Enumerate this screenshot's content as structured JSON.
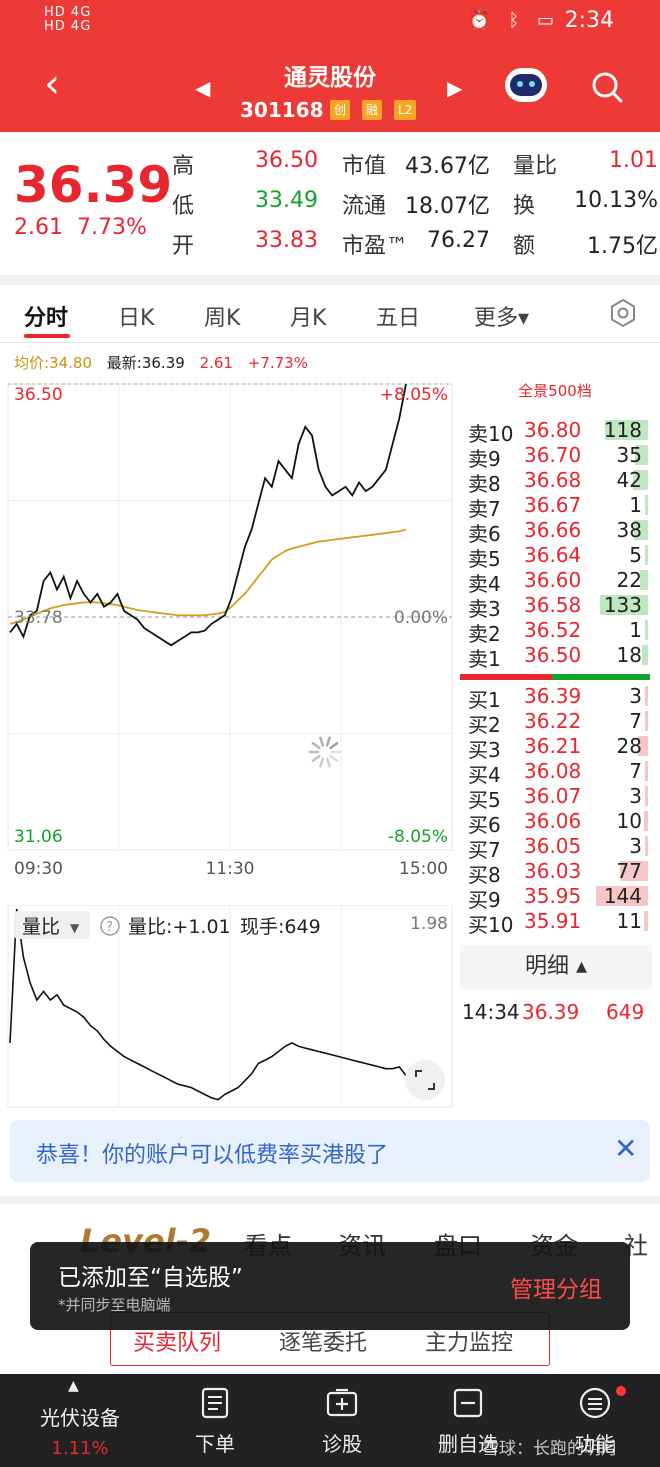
{
  "status_bar": {
    "network_left": "HD 4G",
    "network_left2": "HD 4G",
    "time": "2:34"
  },
  "header": {
    "back_icon": "back-arrow-icon",
    "stock_name": "通灵股份",
    "stock_code": "301168",
    "tags": [
      "创",
      "融",
      "L2"
    ],
    "robot_icon": "robot-icon",
    "search_icon": "search-icon"
  },
  "quote": {
    "price": "36.39",
    "change": "2.61",
    "change_pct": "7.73%",
    "rows": [
      {
        "l1": "高",
        "v1": "36.50",
        "c1": "red",
        "l2": "市值",
        "v2": "43.67亿",
        "l3": "量比",
        "v3": "1.01",
        "c3": "red"
      },
      {
        "l1": "低",
        "v1": "33.49",
        "c1": "green",
        "l2": "流通",
        "v2": "18.07亿",
        "l3": "换",
        "v3": "10.13%",
        "c3": "dark"
      },
      {
        "l1": "开",
        "v1": "33.83",
        "c1": "red",
        "l2": "市盈™",
        "v2": "76.27",
        "l3": "额",
        "v3": "1.75亿",
        "c3": "dark"
      }
    ]
  },
  "tabs": [
    "分时",
    "日K",
    "周K",
    "月K",
    "五日",
    "更多▾"
  ],
  "chart_info": {
    "avg_label": "均价:34.80",
    "latest_label": "最新:36.39",
    "change": "2.61",
    "change_pct": "+7.73%"
  },
  "chart_data": [
    {
      "type": "line",
      "y_top_label": "36.50",
      "y_mid_label": "33.78",
      "y_bottom_label": "31.06",
      "pct_top_label": "+8.05%",
      "pct_mid_label": "0.00%",
      "pct_bottom_label": "-8.05%",
      "x_labels": [
        "09:30",
        "11:30",
        "15:00"
      ],
      "ylim": [
        31.06,
        36.5
      ],
      "prev_close": 33.78,
      "series": [
        {
          "values": [
            33.6,
            33.7,
            33.55,
            33.8,
            33.85,
            34.2,
            34.3,
            34.1,
            34.25,
            34.0,
            34.2,
            34.05,
            33.95,
            34.05,
            33.9,
            33.95,
            34.05,
            33.85,
            33.8,
            33.75,
            33.65,
            33.6,
            33.55,
            33.5,
            33.45,
            33.5,
            33.55,
            33.6,
            33.6,
            33.62,
            33.7,
            33.75,
            33.8,
            34.0,
            34.3,
            34.6,
            34.8,
            35.1,
            35.4,
            35.3,
            35.6,
            35.5,
            35.4,
            35.8,
            36.0,
            35.9,
            35.5,
            35.3,
            35.2,
            35.25,
            35.3,
            35.2,
            35.35,
            35.25,
            35.3,
            35.4,
            35.5,
            35.8,
            36.1,
            36.5
          ]
        },
        {
          "values": [
            33.7,
            33.72,
            33.75,
            33.78,
            33.82,
            33.85,
            33.88,
            33.9,
            33.92,
            33.93,
            33.94,
            33.95,
            33.95,
            33.95,
            33.94,
            33.93,
            33.92,
            33.9,
            33.88,
            33.86,
            33.85,
            33.84,
            33.83,
            33.82,
            33.81,
            33.8,
            33.8,
            33.8,
            33.8,
            33.8,
            33.81,
            33.82,
            33.84,
            33.9,
            33.98,
            34.05,
            34.15,
            34.25,
            34.35,
            34.45,
            34.5,
            34.55,
            34.58,
            34.6,
            34.62,
            34.64,
            34.66,
            34.67,
            34.68,
            34.69,
            34.7,
            34.71,
            34.72,
            34.73,
            34.74,
            34.75,
            34.76,
            34.77,
            34.78,
            34.8
          ]
        }
      ]
    },
    {
      "type": "line",
      "label": "量比",
      "value_label": "量比:+1.01",
      "hand_label": "现手:649",
      "max_label": "1.98",
      "ylim": [
        0.85,
        1.98
      ],
      "series": [
        {
          "values": [
            1.2,
            1.98,
            1.7,
            1.55,
            1.45,
            1.5,
            1.45,
            1.48,
            1.42,
            1.4,
            1.38,
            1.35,
            1.3,
            1.27,
            1.22,
            1.18,
            1.15,
            1.12,
            1.1,
            1.08,
            1.06,
            1.04,
            1.02,
            1.0,
            0.98,
            0.96,
            0.95,
            0.94,
            0.92,
            0.9,
            0.88,
            0.87,
            0.9,
            0.92,
            0.94,
            0.98,
            1.02,
            1.08,
            1.1,
            1.12,
            1.15,
            1.18,
            1.2,
            1.18,
            1.17,
            1.16,
            1.15,
            1.14,
            1.13,
            1.12,
            1.11,
            1.1,
            1.09,
            1.08,
            1.07,
            1.06,
            1.05,
            1.05,
            1.06,
            1.01
          ]
        }
      ]
    }
  ],
  "order_book": {
    "title": "全景500档",
    "sells": [
      {
        "label": "卖10",
        "price": "36.80",
        "vol": "118"
      },
      {
        "label": "卖9",
        "price": "36.70",
        "vol": "35"
      },
      {
        "label": "卖8",
        "price": "36.68",
        "vol": "42"
      },
      {
        "label": "卖7",
        "price": "36.67",
        "vol": "1"
      },
      {
        "label": "卖6",
        "price": "36.66",
        "vol": "38"
      },
      {
        "label": "卖5",
        "price": "36.64",
        "vol": "5"
      },
      {
        "label": "卖4",
        "price": "36.60",
        "vol": "22"
      },
      {
        "label": "卖3",
        "price": "36.58",
        "vol": "133"
      },
      {
        "label": "卖2",
        "price": "36.52",
        "vol": "1"
      },
      {
        "label": "卖1",
        "price": "36.50",
        "vol": "18"
      }
    ],
    "buys": [
      {
        "label": "买1",
        "price": "36.39",
        "vol": "3"
      },
      {
        "label": "买2",
        "price": "36.22",
        "vol": "7"
      },
      {
        "label": "买3",
        "price": "36.21",
        "vol": "28"
      },
      {
        "label": "买4",
        "price": "36.08",
        "vol": "7"
      },
      {
        "label": "买5",
        "price": "36.07",
        "vol": "3"
      },
      {
        "label": "买6",
        "price": "36.06",
        "vol": "10"
      },
      {
        "label": "买7",
        "price": "36.05",
        "vol": "3"
      },
      {
        "label": "买8",
        "price": "36.03",
        "vol": "77"
      },
      {
        "label": "买9",
        "price": "35.95",
        "vol": "144"
      },
      {
        "label": "买10",
        "price": "35.91",
        "vol": "11"
      }
    ],
    "detail_label": "明细 ▴",
    "tick": {
      "time": "14:34",
      "price": "36.39",
      "vol": "649"
    }
  },
  "banner": {
    "text": "恭喜！你的账户可以低费率买港股了",
    "close_icon": "close-icon"
  },
  "level2": {
    "brand": "Level-2",
    "tabs": [
      "看点",
      "资讯",
      "盘口",
      "资金",
      "社"
    ],
    "subtabs": [
      "买卖队列",
      "逐笔委托",
      "主力监控"
    ]
  },
  "toast": {
    "title": "已添加至“自选股”",
    "subtitle": "*并同步至电脑端",
    "action": "管理分组"
  },
  "bottom_nav": {
    "stock": {
      "name": "光伏设备",
      "pct": "1.11%"
    },
    "items": [
      {
        "label": "下单",
        "icon": "order-icon"
      },
      {
        "label": "诊股",
        "icon": "diagnose-icon"
      },
      {
        "label": "删自选",
        "icon": "remove-favorite-icon"
      },
      {
        "label": "功能",
        "icon": "menu-icon"
      }
    ]
  },
  "watermark": "雪球：长跑的明月",
  "colors": {
    "up": "#e8262f",
    "down": "#12a32a",
    "avg_line": "#d4a017",
    "header_bg": "#ee3a36"
  }
}
